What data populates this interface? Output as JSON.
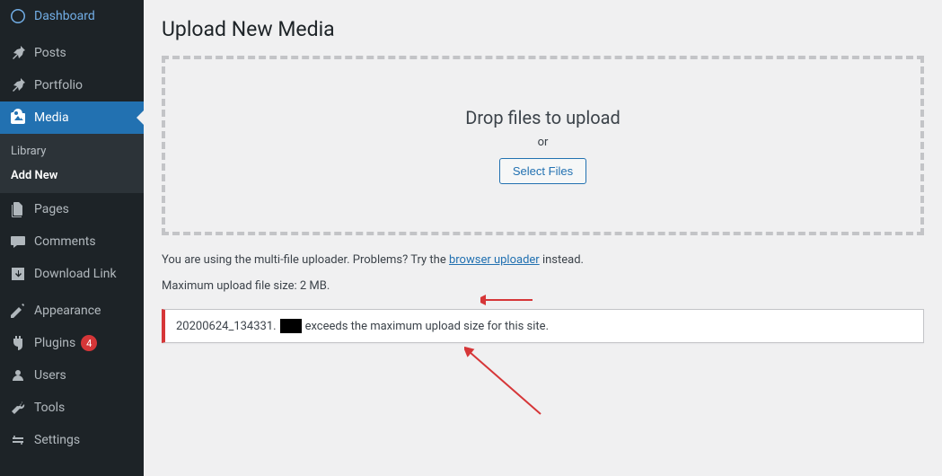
{
  "sidebar": {
    "items": [
      {
        "label": "Dashboard",
        "icon": "dashboard"
      },
      {
        "label": "Posts",
        "icon": "pin"
      },
      {
        "label": "Portfolio",
        "icon": "pin"
      },
      {
        "label": "Media",
        "icon": "media",
        "active": true
      },
      {
        "label": "Pages",
        "icon": "pages"
      },
      {
        "label": "Comments",
        "icon": "comments"
      },
      {
        "label": "Download Link",
        "icon": "download"
      },
      {
        "label": "Appearance",
        "icon": "appearance"
      },
      {
        "label": "Plugins",
        "icon": "plugins",
        "badge": "4"
      },
      {
        "label": "Users",
        "icon": "users"
      },
      {
        "label": "Tools",
        "icon": "tools"
      },
      {
        "label": "Settings",
        "icon": "settings"
      }
    ],
    "submenu": {
      "items": [
        {
          "label": "Library"
        },
        {
          "label": "Add New",
          "active": true
        }
      ]
    }
  },
  "main": {
    "title": "Upload New Media",
    "dropzone": {
      "title": "Drop files to upload",
      "or": "or",
      "button": "Select Files"
    },
    "note_prefix": "You are using the multi-file uploader. Problems? Try the ",
    "note_link": "browser uploader",
    "note_suffix": " instead.",
    "max_size": "Maximum upload file size: 2 MB.",
    "error": {
      "filename": "20200624_134331.",
      "message": "exceeds the maximum upload size for this site."
    }
  }
}
